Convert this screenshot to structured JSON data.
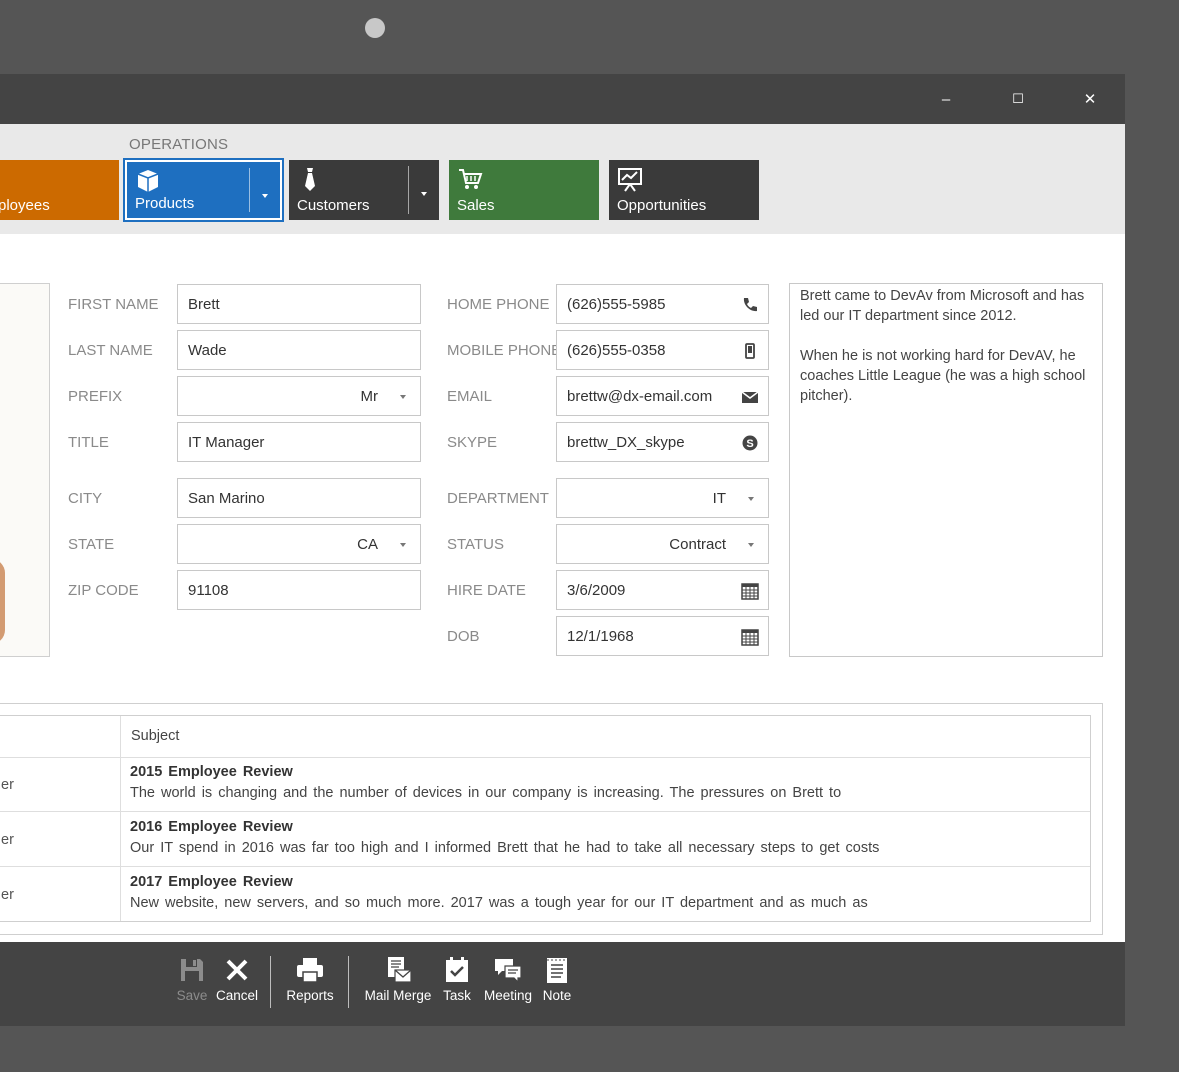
{
  "window": {
    "controls": {
      "minimize": "–",
      "maximize": "☐",
      "close": "✕"
    }
  },
  "ribbon": {
    "group_label": "OPERATIONS",
    "tiles": [
      {
        "label": "ployees",
        "color": "#cc6a00",
        "icon": "employees-icon"
      },
      {
        "label": "Products",
        "color": "#1e6fc0",
        "icon": "box-icon",
        "selected": true,
        "split": true
      },
      {
        "label": "Customers",
        "color": "#3a3a3a",
        "icon": "tie-icon",
        "split": true
      },
      {
        "label": "Sales",
        "color": "#3f7a3c",
        "icon": "cart-icon"
      },
      {
        "label": "Opportunities",
        "color": "#3a3a3a",
        "icon": "presentation-icon"
      }
    ]
  },
  "form": {
    "left": [
      {
        "label": "FIRST NAME",
        "value": "Brett"
      },
      {
        "label": "LAST NAME",
        "value": "Wade"
      },
      {
        "label": "PREFIX",
        "value": "Mr",
        "type": "dropdown"
      },
      {
        "label": "TITLE",
        "value": "IT Manager"
      },
      {
        "label": "CITY",
        "value": "San Marino"
      },
      {
        "label": "STATE",
        "value": "CA",
        "type": "dropdown"
      },
      {
        "label": "ZIP CODE",
        "value": "91108"
      }
    ],
    "right": [
      {
        "label": "HOME PHONE",
        "value": "(626)555-5985",
        "icon": "phone-icon"
      },
      {
        "label": "MOBILE PHONE",
        "value": "(626)555-0358",
        "icon": "mobile-icon"
      },
      {
        "label": "EMAIL",
        "value": "brettw@dx-email.com",
        "icon": "mail-icon"
      },
      {
        "label": "SKYPE",
        "value": "brettw_DX_skype",
        "icon": "skype-icon"
      },
      {
        "label": "DEPARTMENT",
        "value": "IT",
        "type": "dropdown"
      },
      {
        "label": "STATUS",
        "value": "Contract",
        "type": "dropdown"
      },
      {
        "label": "HIRE DATE",
        "value": "3/6/2009",
        "icon": "calendar-icon"
      },
      {
        "label": "DOB",
        "value": "12/1/1968",
        "icon": "calendar-icon"
      }
    ],
    "notes": [
      "Brett came to DevAv from Microsoft and has led our IT department since 2012.",
      "When he is not working hard for DevAV, he coaches Little League (he was a high school pitcher)."
    ]
  },
  "grid": {
    "header": "Subject",
    "rows": [
      {
        "cut": "er",
        "subject": "2015 Employee Review",
        "body": "The world is changing and the number of devices in our company is increasing. The pressures on Brett to"
      },
      {
        "cut": "er",
        "subject": "2016 Employee Review",
        "body": "Our IT spend in 2016 was far too high and I informed Brett that he had to take all necessary steps to get costs"
      },
      {
        "cut": "er",
        "subject": "2017 Employee Review",
        "body": "New website, new servers, and so much more. 2017 was a tough year for our IT department and as much as"
      }
    ]
  },
  "toolbar": {
    "save": "Save",
    "cancel": "Cancel",
    "reports": "Reports",
    "mail_merge": "Mail Merge",
    "task": "Task",
    "meeting": "Meeting",
    "note": "Note"
  }
}
